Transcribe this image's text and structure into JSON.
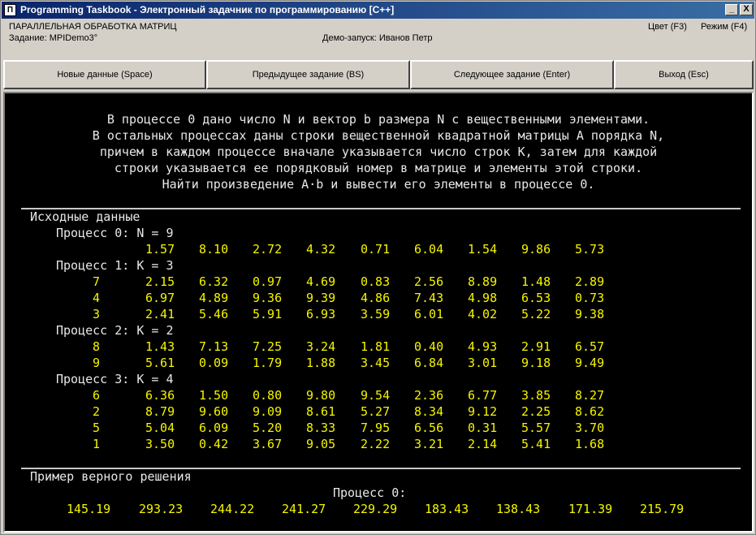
{
  "window": {
    "title": "Programming Taskbook - Электронный задачник по программированию [C++]",
    "icon_glyph": "П",
    "controls": [
      "_",
      "X"
    ]
  },
  "info": {
    "section": "ПАРАЛЛЕЛЬНАЯ ОБРАБОТКА МАТРИЦ",
    "task": "Задание: MPIDemo3°",
    "demo": "Демо-запуск: Иванов Петр",
    "color_mode": "Цвет (F3)",
    "mode": "Режим (F4)"
  },
  "buttons": {
    "new_data": "Новые данные (Space)",
    "prev_task": "Предыдущее задание (BS)",
    "next_task": "Следующее задание (Enter)",
    "exit": "Выход (Esc)"
  },
  "statement": [
    "В процессе 0 дано число N и вектор b размера N с вещественными элементами.",
    "В остальных процессах даны строки вещественной квадратной матрицы A порядка N,",
    "причем в каждом процессе вначале указывается число строк K, затем для каждой",
    "строки указывается ее порядковый номер в матрице и элементы этой строки.",
    "Найти произведение A·b и вывести его элементы в процессе 0."
  ],
  "source": {
    "heading": "Исходные данные",
    "processes": [
      {
        "label": "Процесс 0: N = 9",
        "rows": [
          {
            "index": "",
            "values": [
              "1.57",
              "8.10",
              "2.72",
              "4.32",
              "0.71",
              "6.04",
              "1.54",
              "9.86",
              "5.73"
            ]
          }
        ]
      },
      {
        "label": "Процесс 1: K = 3",
        "rows": [
          {
            "index": "7",
            "values": [
              "2.15",
              "6.32",
              "0.97",
              "4.69",
              "0.83",
              "2.56",
              "8.89",
              "1.48",
              "2.89"
            ]
          },
          {
            "index": "4",
            "values": [
              "6.97",
              "4.89",
              "9.36",
              "9.39",
              "4.86",
              "7.43",
              "4.98",
              "6.53",
              "0.73"
            ]
          },
          {
            "index": "3",
            "values": [
              "2.41",
              "5.46",
              "5.91",
              "6.93",
              "3.59",
              "6.01",
              "4.02",
              "5.22",
              "9.38"
            ]
          }
        ]
      },
      {
        "label": "Процесс 2: K = 2",
        "rows": [
          {
            "index": "8",
            "values": [
              "1.43",
              "7.13",
              "7.25",
              "3.24",
              "1.81",
              "0.40",
              "4.93",
              "2.91",
              "6.57"
            ]
          },
          {
            "index": "9",
            "values": [
              "5.61",
              "0.09",
              "1.79",
              "1.88",
              "3.45",
              "6.84",
              "3.01",
              "9.18",
              "9.49"
            ]
          }
        ]
      },
      {
        "label": "Процесс 3: K = 4",
        "rows": [
          {
            "index": "6",
            "values": [
              "6.36",
              "1.50",
              "0.80",
              "9.80",
              "9.54",
              "2.36",
              "6.77",
              "3.85",
              "8.27"
            ]
          },
          {
            "index": "2",
            "values": [
              "8.79",
              "9.60",
              "9.09",
              "8.61",
              "5.27",
              "8.34",
              "9.12",
              "2.25",
              "8.62"
            ]
          },
          {
            "index": "5",
            "values": [
              "5.04",
              "6.09",
              "5.20",
              "8.33",
              "7.95",
              "6.56",
              "0.31",
              "5.57",
              "3.70"
            ]
          },
          {
            "index": "1",
            "values": [
              "3.50",
              "0.42",
              "3.67",
              "9.05",
              "2.22",
              "3.21",
              "2.14",
              "5.41",
              "1.68"
            ]
          }
        ]
      }
    ]
  },
  "solution": {
    "heading": "Пример верного решения",
    "process_label": "Процесс 0:",
    "values": [
      "145.19",
      "293.23",
      "244.22",
      "241.27",
      "229.29",
      "183.43",
      "138.43",
      "171.39",
      "215.79"
    ]
  }
}
